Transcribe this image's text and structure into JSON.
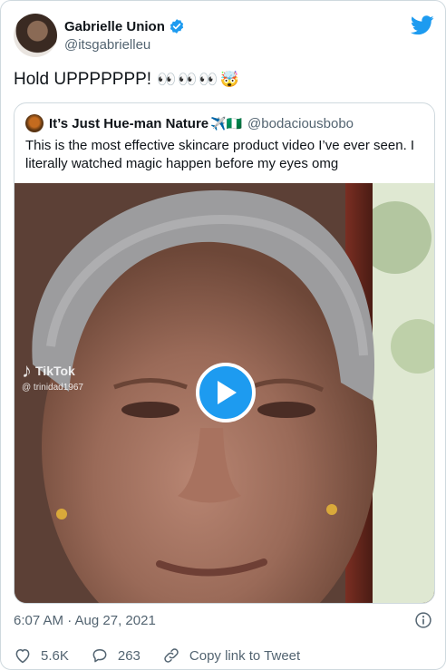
{
  "author": {
    "display_name": "Gabrielle Union",
    "handle": "@itsgabrielleu",
    "verified_icon": "verified-badge-icon"
  },
  "tweet": {
    "text": "Hold UPPPPPPP!",
    "emoji": "👀👀👀🤯"
  },
  "quoted": {
    "display_name": "It’s Just Hue-man Nature",
    "name_emoji": "✈️🇳🇬",
    "handle": "@bodaciousbobo",
    "text": "This is the most effective skincare product video I’ve ever seen. I literally watched magic happen before my eyes omg",
    "watermark_brand": "TikTok",
    "watermark_user": "@ trinidad1967"
  },
  "meta": {
    "timestamp": "6:07 AM · Aug 27, 2021"
  },
  "actions": {
    "likes": "5.6K",
    "replies": "263",
    "copy_link_label": "Copy link to Tweet"
  },
  "colors": {
    "twitter_blue": "#1d9bf0",
    "secondary_text": "#536471",
    "border": "#cfd9de"
  }
}
